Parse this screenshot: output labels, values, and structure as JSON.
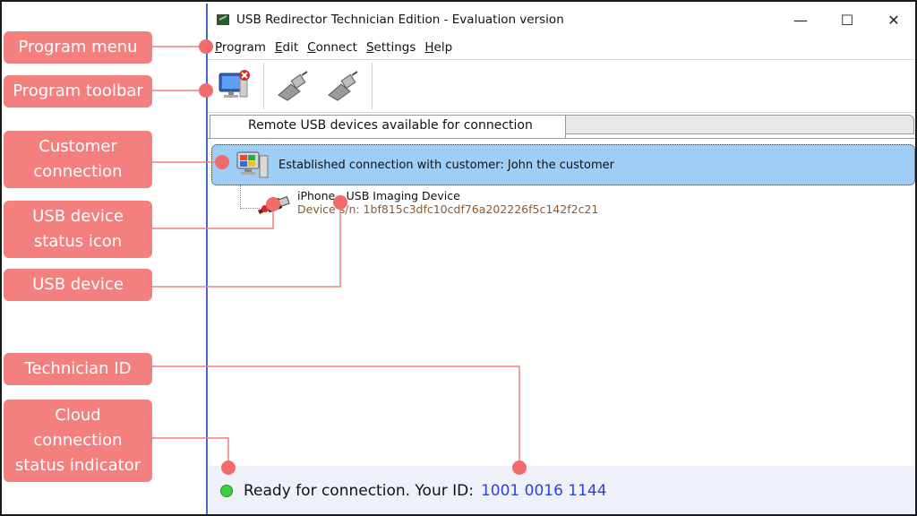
{
  "window": {
    "title": "USB Redirector Technician Edition - Evaluation version",
    "minimize": "—",
    "maximize": "☐",
    "close": "✕"
  },
  "menu": [
    "Program",
    "Edit",
    "Connect",
    "Settings",
    "Help"
  ],
  "toolbar": {
    "buttons": [
      "disconnect-computer-icon",
      "connect-usb-icon",
      "disconnect-usb-icon"
    ]
  },
  "tabs": {
    "active": "Remote USB devices available for connection"
  },
  "customer": {
    "label": "Established connection with customer: John the customer"
  },
  "device": {
    "name": "iPhone - USB Imaging Device",
    "serial": "Device s/n: 1bf815c3dfc10cdf76a202226f5c142f2c21"
  },
  "status": {
    "text": "Ready for connection. Your ID:",
    "id": "1001 0016 1144",
    "indicator_color": "#3ed13e"
  },
  "callouts": {
    "program_menu": "Program menu",
    "program_toolbar": "Program toolbar",
    "customer_connection_1": "Customer",
    "customer_connection_2": "connection",
    "usb_status_1": "USB device",
    "usb_status_2": "status icon",
    "usb_device": "USB device",
    "technician_id": "Technician ID",
    "cloud_1": "Cloud",
    "cloud_2": "connection",
    "cloud_3": "status indicator"
  },
  "colors": {
    "callout": "#f37f7f",
    "selection": "#9ecdf5",
    "id_text": "#2c44d6",
    "serial_text": "#8b5a2b"
  }
}
